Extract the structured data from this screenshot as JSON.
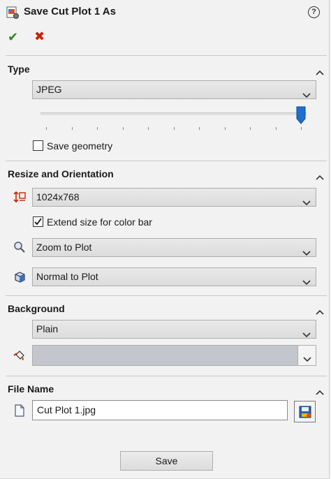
{
  "header": {
    "title": "Save Cut Plot 1 As",
    "help_label": "?"
  },
  "actions": {
    "ok_glyph": "✔",
    "cancel_glyph": "✖"
  },
  "type_section": {
    "title": "Type",
    "format_value": "JPEG",
    "quality_level": 1.0,
    "save_geometry_label": "Save geometry",
    "save_geometry_checked": false
  },
  "resize_section": {
    "title": "Resize and Orientation",
    "size_value": "1024x768",
    "extend_label": "Extend size for color bar",
    "extend_checked": true,
    "zoom_value": "Zoom to Plot",
    "orientation_value": "Normal to Plot"
  },
  "background_section": {
    "title": "Background",
    "mode_value": "Plain",
    "color": "#c3c7cd"
  },
  "file_section": {
    "title": "File Name",
    "file_value": "Cut Plot 1.jpg"
  },
  "footer": {
    "save_label": "Save"
  },
  "icons": [
    "save-plot-icon",
    "help-icon",
    "ok-check-icon",
    "cancel-x-icon",
    "collapse-chevron-icon",
    "dropdown-chevron-icon",
    "resize-icon",
    "zoom-magnifier-icon",
    "view-orientation-cube-icon",
    "paint-bucket-icon",
    "document-icon",
    "browse-folder-icon"
  ],
  "colors": {
    "accent": "#1f6fd1",
    "ok": "#2e8b1f",
    "cancel": "#cc2200"
  }
}
